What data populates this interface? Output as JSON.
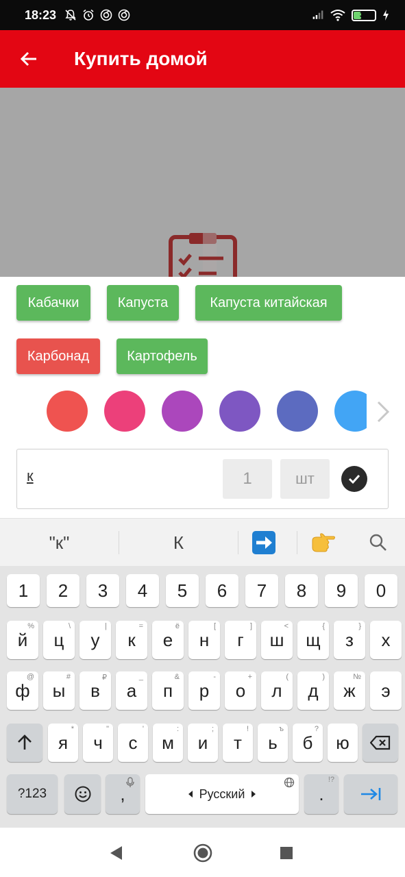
{
  "status_bar": {
    "time": "18:23",
    "battery_level": "35",
    "icons": [
      "notifications-off-icon",
      "alarm-icon",
      "sync-icon",
      "sync-icon",
      "signal-icon",
      "wifi-icon",
      "battery-icon",
      "charging-icon"
    ]
  },
  "app_bar": {
    "title": "Купить домой",
    "back_icon": "arrow-back-icon"
  },
  "suggestions": {
    "chips": [
      {
        "label": "Кабачки",
        "color": "#5cb85c"
      },
      {
        "label": "Капуста",
        "color": "#5cb85c"
      },
      {
        "label": "Капуста китайская",
        "color": "#5cb85c"
      },
      {
        "label": "Карбонад",
        "color": "#e8534e"
      },
      {
        "label": "Картофель",
        "color": "#5cb85c"
      }
    ]
  },
  "colors": [
    "#ef5350",
    "#ec407a",
    "#ab47bc",
    "#7e57c2",
    "#5c6bc0",
    "#42a5f5"
  ],
  "input": {
    "name_value": "к",
    "quantity": "1",
    "unit": "шт",
    "confirm_icon": "check-icon"
  },
  "keyboard_suggestions": {
    "quoted": "\"к\"",
    "capital": "К",
    "emoji_1": "arrow-right-emoji",
    "emoji_2": "pointing-hand-emoji"
  },
  "keyboard": {
    "digits": [
      "1",
      "2",
      "3",
      "4",
      "5",
      "6",
      "7",
      "8",
      "9",
      "0"
    ],
    "row1": [
      [
        "й",
        "%"
      ],
      [
        "ц",
        "\\"
      ],
      [
        "у",
        "|"
      ],
      [
        "к",
        "="
      ],
      [
        "е",
        "ё"
      ],
      [
        "н",
        "["
      ],
      [
        "г",
        "]"
      ],
      [
        "ш",
        "<"
      ],
      [
        "щ",
        "{"
      ],
      [
        "з",
        "}"
      ],
      [
        "х",
        ""
      ]
    ],
    "row2": [
      [
        "ф",
        "@"
      ],
      [
        "ы",
        "#"
      ],
      [
        "в",
        "₽"
      ],
      [
        "а",
        "_"
      ],
      [
        "п",
        "&"
      ],
      [
        "р",
        "-"
      ],
      [
        "о",
        "+"
      ],
      [
        "л",
        "("
      ],
      [
        "д",
        ")"
      ],
      [
        "ж",
        "№"
      ],
      [
        "э",
        ""
      ]
    ],
    "row3": [
      [
        "я",
        "*"
      ],
      [
        "ч",
        "\""
      ],
      [
        "с",
        "'"
      ],
      [
        "м",
        ":"
      ],
      [
        "и",
        ";"
      ],
      [
        "т",
        "!"
      ],
      [
        "ь",
        "ъ"
      ],
      [
        "б",
        "?"
      ],
      [
        "ю",
        ""
      ]
    ],
    "symbols_label": "?123",
    "comma": ",",
    "space_label": "Русский",
    "period": ".",
    "period_hint": "!?"
  },
  "accent_color": "#e30613"
}
